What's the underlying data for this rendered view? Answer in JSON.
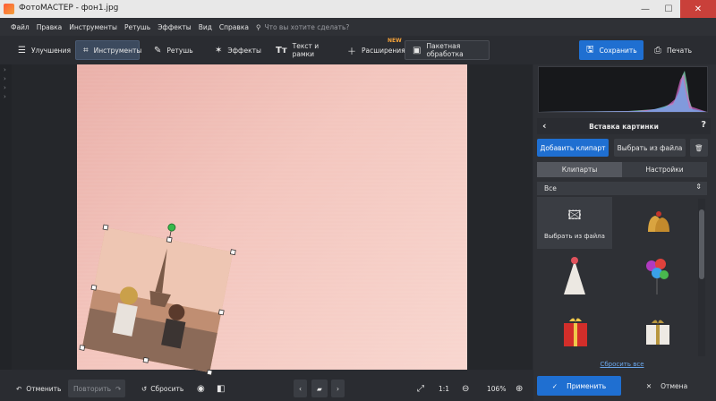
{
  "window": {
    "title": "ФотоМАСТЕР - фон1.jpg",
    "minimize": "—",
    "maximize": "☐",
    "close": "✕"
  },
  "menu": {
    "items": [
      "Файл",
      "Правка",
      "Инструменты",
      "Ретушь",
      "Эффекты",
      "Вид",
      "Справка"
    ],
    "search_placeholder": "Что вы хотите сделать?"
  },
  "toolbar": {
    "tabs": [
      {
        "label": "Улучшения",
        "icon": "sliders-icon"
      },
      {
        "label": "Инструменты",
        "icon": "crop-icon",
        "active": true
      },
      {
        "label": "Ретушь",
        "icon": "brush-icon"
      },
      {
        "label": "Эффекты",
        "icon": "magic-wand-icon"
      },
      {
        "label": "Текст и рамки",
        "icon": "text-icon"
      },
      {
        "label": "Расширения",
        "icon": "plus-icon"
      },
      {
        "label": "Пакетная обработка",
        "icon": "images-icon"
      }
    ],
    "new_badge": "NEW",
    "save_label": "Сохранить",
    "print_label": "Печать"
  },
  "panel": {
    "title": "Вставка картинки",
    "add_clipart": "Добавить клипарт",
    "choose_file": "Выбрать из файла",
    "tabs": [
      "Клипарты",
      "Настройки"
    ],
    "category": "Все",
    "file_tile_label": "Выбрать из файла",
    "cliparts": [
      "bells-icon",
      "party-hat-icon",
      "balloons-icon",
      "gift-box-red-icon",
      "gift-box-white-icon"
    ],
    "reset_all": "Сбросить все",
    "apply": "Применить",
    "cancel": "Отмена"
  },
  "bottom": {
    "undo": "Отменить",
    "redo": "Повторить",
    "reset": "Сбросить",
    "ratio": "1:1",
    "zoom": "106%"
  },
  "colors": {
    "accent": "#1f6fd1",
    "badge": "#f4a23a",
    "link": "#6aa6ea"
  }
}
